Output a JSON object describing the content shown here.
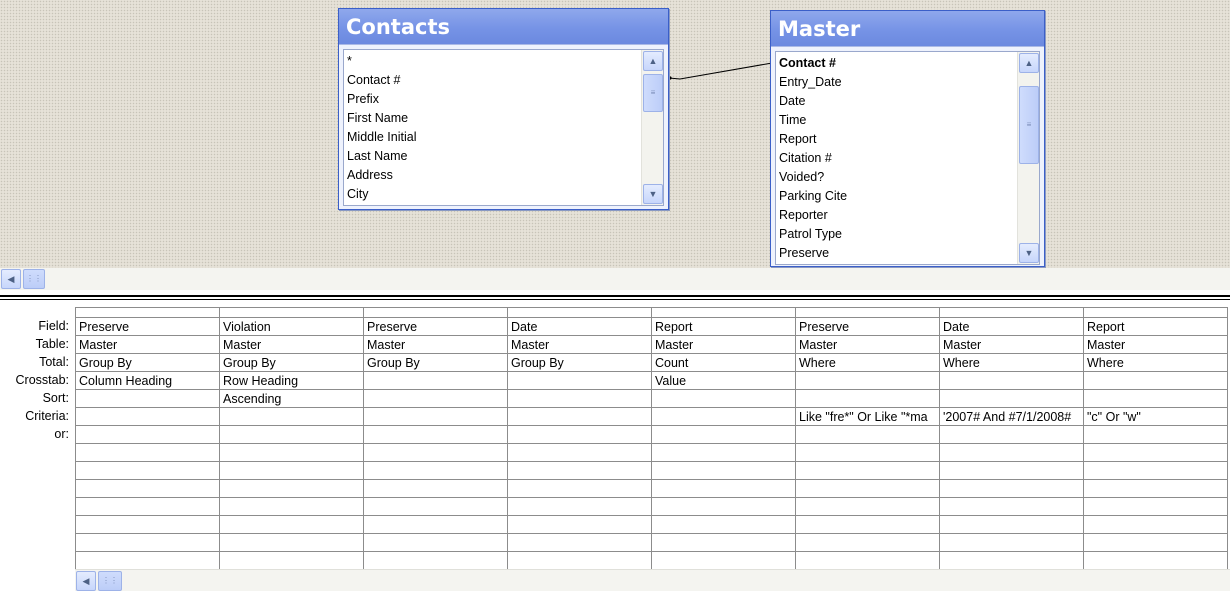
{
  "tables": [
    {
      "title": "Contacts",
      "fields": [
        "*",
        "Contact #",
        "Prefix",
        "First Name",
        "Middle Initial",
        "Last Name",
        "Address",
        "City"
      ],
      "key_field": ""
    },
    {
      "title": "Master",
      "fields": [
        "Contact #",
        "Entry_Date",
        "Date",
        "Time",
        "Report",
        "Citation #",
        "Voided?",
        "Parking Cite",
        "Reporter",
        "Patrol Type",
        "Preserve"
      ],
      "key_field": "Contact #"
    }
  ],
  "grid": {
    "row_labels": [
      "Field:",
      "Table:",
      "Total:",
      "Crosstab:",
      "Sort:",
      "Criteria:",
      "or:"
    ],
    "columns": [
      {
        "field": "Preserve",
        "table": "Master",
        "total": "Group By",
        "crosstab": "Column Heading",
        "sort": "",
        "criteria": "",
        "or": ""
      },
      {
        "field": "Violation",
        "table": "Master",
        "total": "Group By",
        "crosstab": "Row Heading",
        "sort": "Ascending",
        "criteria": "",
        "or": ""
      },
      {
        "field": "Preserve",
        "table": "Master",
        "total": "Group By",
        "crosstab": "",
        "sort": "",
        "criteria": "",
        "or": ""
      },
      {
        "field": "Date",
        "table": "Master",
        "total": "Group By",
        "crosstab": "",
        "sort": "",
        "criteria": "",
        "or": ""
      },
      {
        "field": "Report",
        "table": "Master",
        "total": "Count",
        "crosstab": "Value",
        "sort": "",
        "criteria": "",
        "or": ""
      },
      {
        "field": "Preserve",
        "table": "Master",
        "total": "Where",
        "crosstab": "",
        "sort": "",
        "criteria": "Like \"fre*\" Or Like \"*ma",
        "or": ""
      },
      {
        "field": "Date",
        "table": "Master",
        "total": "Where",
        "crosstab": "",
        "sort": "",
        "criteria": "'2007# And #7/1/2008#",
        "or": ""
      },
      {
        "field": "Report",
        "table": "Master",
        "total": "Where",
        "crosstab": "",
        "sort": "",
        "criteria": "\"c\" Or \"w\"",
        "or": ""
      }
    ]
  },
  "colors": {
    "title_bar": "#7693e6",
    "table_border": "#3b5fc8",
    "upper_background": "#e6e2d8"
  },
  "icons": {
    "scroll_up": "chevron-up-icon",
    "scroll_down": "chevron-down-icon",
    "scroll_left": "chevron-left-icon",
    "thumb_grip": "grip-icon"
  }
}
